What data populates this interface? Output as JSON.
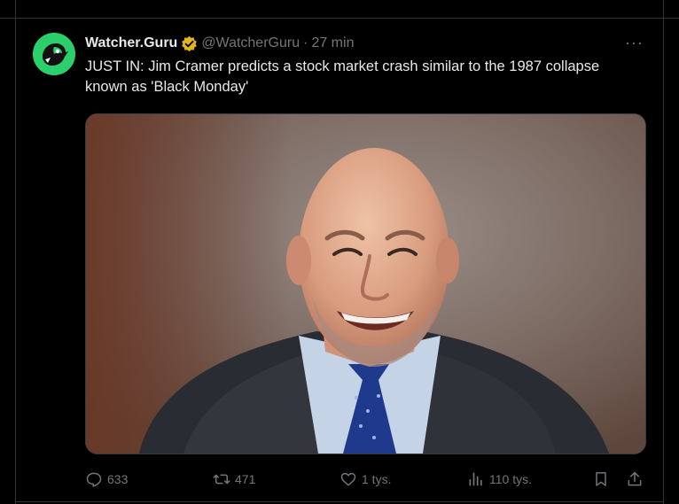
{
  "tweet": {
    "author_name": "Watcher.Guru",
    "handle": "@WatcherGuru",
    "separator": "·",
    "time": "27 min",
    "more": "···",
    "text": "JUST IN: Jim Cramer predicts a stock market crash similar to the 1987 collapse known as 'Black Monday'",
    "verified_color": "#e2b719",
    "avatar_color": "#2bcf6c"
  },
  "actions": {
    "replies": "633",
    "reposts": "471",
    "likes": "1 tys.",
    "views": "110 tys."
  },
  "icons": [
    "reply-icon",
    "repost-icon",
    "like-icon",
    "views-icon",
    "bookmark-icon",
    "share-icon",
    "more-icon",
    "verified-badge-icon"
  ]
}
